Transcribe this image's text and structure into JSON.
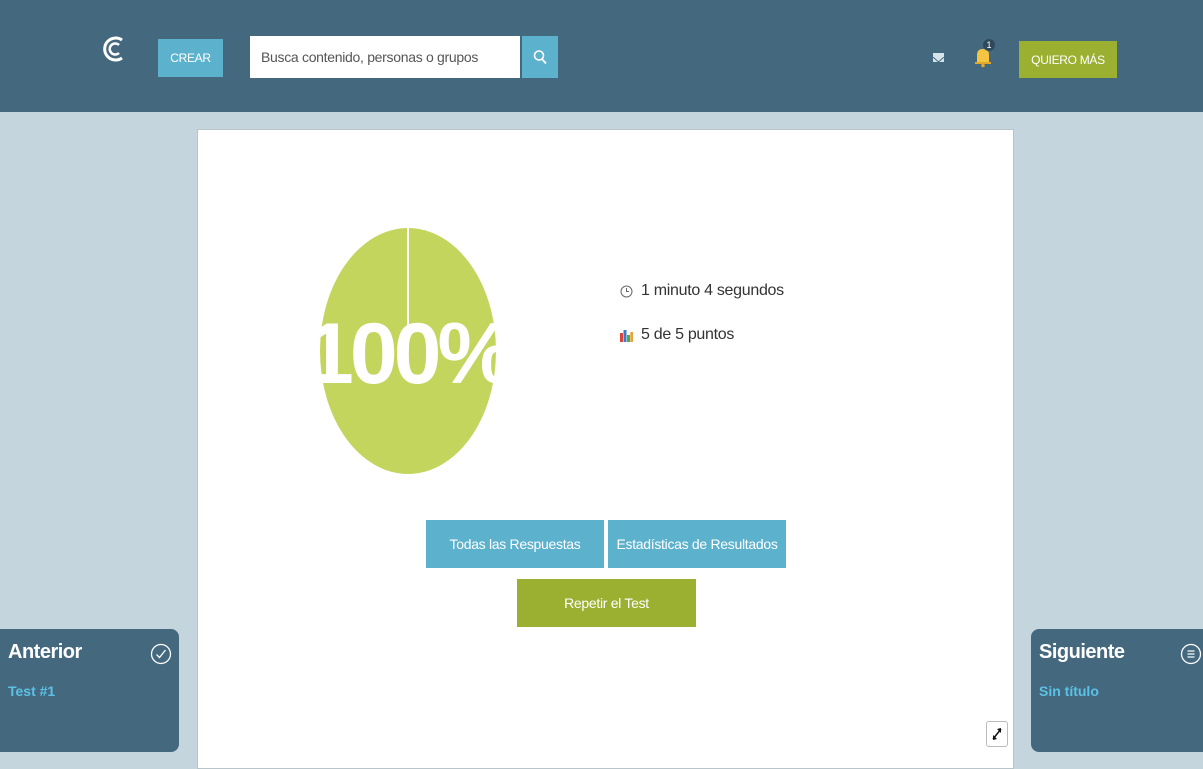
{
  "header": {
    "crear_label": "CREAR",
    "search_placeholder": "Busca contenido, personas o grupos",
    "notifications_count": "1",
    "quiero_label": "QUIERO MÁS",
    "accent": "#5cb1cd",
    "brand_green": "#9bb030",
    "bar_color": "#44697f"
  },
  "result": {
    "score_percent": "100%",
    "score_value": 100,
    "time_label": "1 minuto 4 segundos",
    "points_label": "5 de 5 puntos",
    "pie_color": "#c4d55e"
  },
  "actions": {
    "all_answers": "Todas las Respuestas",
    "stats": "Estadísticas de Resultados",
    "repeat": "Repetir el Test"
  },
  "nav": {
    "prev_title": "Anterior",
    "prev_item": "Test #1",
    "next_title": "Siguiente",
    "next_item": "Sin título"
  },
  "icons": {
    "logo": "logo-icon",
    "search": "search-icon",
    "mail": "mail-icon",
    "bell": "bell-icon",
    "clock": "clock-icon",
    "chart": "bar-chart-icon",
    "expand": "expand-icon",
    "check": "check-circle-icon",
    "list": "list-circle-icon"
  }
}
